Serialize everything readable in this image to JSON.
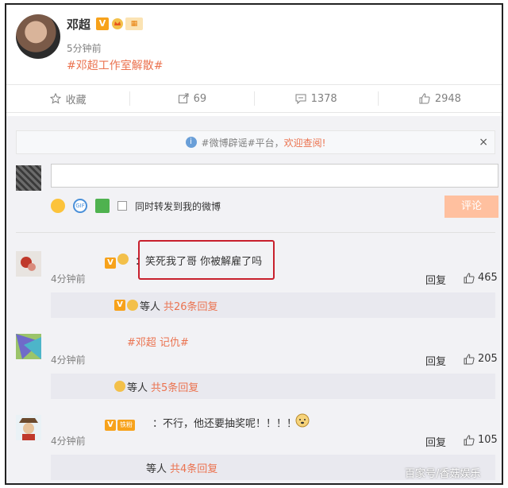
{
  "post": {
    "author": "邓超",
    "verified_badge": "V",
    "time": "5分钟前",
    "tag": "#邓超工作室解散#"
  },
  "actions": {
    "favorite": "收藏",
    "repost": "69",
    "comment": "1378",
    "like": "2948"
  },
  "notice": {
    "prefix": "#微博辟谣#平台，",
    "link": "欢迎查阅!",
    "close": "×"
  },
  "composer": {
    "checkbox_label": "同时转发到我的微博",
    "submit": "评论",
    "gif_label": "GIF"
  },
  "comments": [
    {
      "text": "：笑死我了哥 你被解雇了吗",
      "time": "4分钟前",
      "reply": "回复",
      "likes": "465",
      "sub_prefix": "等人",
      "sub_count": "共26条回复"
    },
    {
      "text": "#邓超 记仇#",
      "time": "4分钟前",
      "reply": "回复",
      "likes": "205",
      "sub_prefix": "等人",
      "sub_count": "共5条回复"
    },
    {
      "text": "：不行，他还要抽奖呢！！！！",
      "time": "4分钟前",
      "reply": "回复",
      "likes": "105",
      "sub_prefix": "等人",
      "sub_count": "共4条回复",
      "fan_badge": "铁粉"
    }
  ],
  "watermark": "百家号/香菇娱乐",
  "colors": {
    "accent": "#eb7350",
    "highlight": "#c8202d",
    "submit_bg": "#ffc09f",
    "badge": "#f7a21b"
  }
}
